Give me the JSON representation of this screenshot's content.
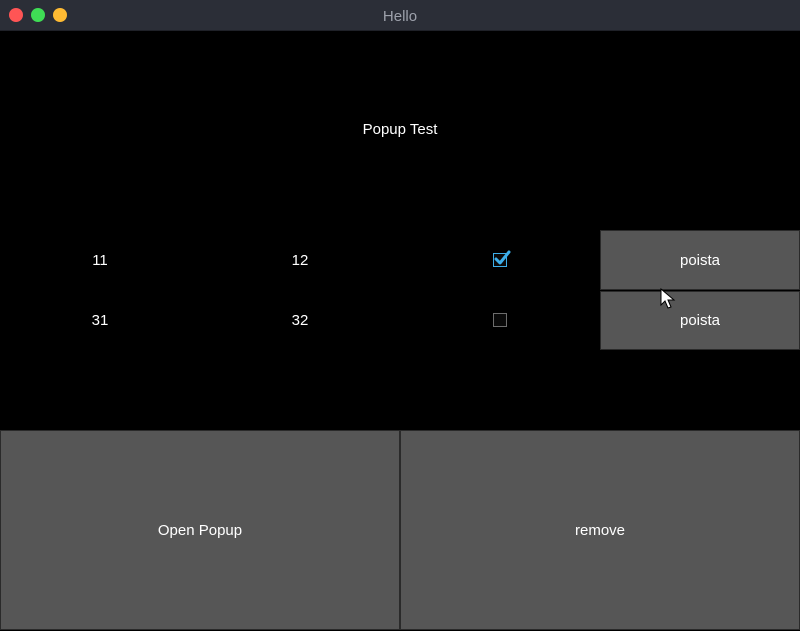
{
  "window": {
    "title": "Hello"
  },
  "heading": "Popup Test",
  "rows": [
    {
      "col1": "11",
      "col2": "12",
      "checked": true,
      "button_label": "poista"
    },
    {
      "col1": "31",
      "col2": "32",
      "checked": false,
      "button_label": "poista"
    }
  ],
  "bottom": {
    "open_label": "Open Popup",
    "remove_label": "remove"
  },
  "colors": {
    "accent": "#3daee9",
    "button_bg": "#565656",
    "titlebar_bg": "#2b2e37"
  }
}
